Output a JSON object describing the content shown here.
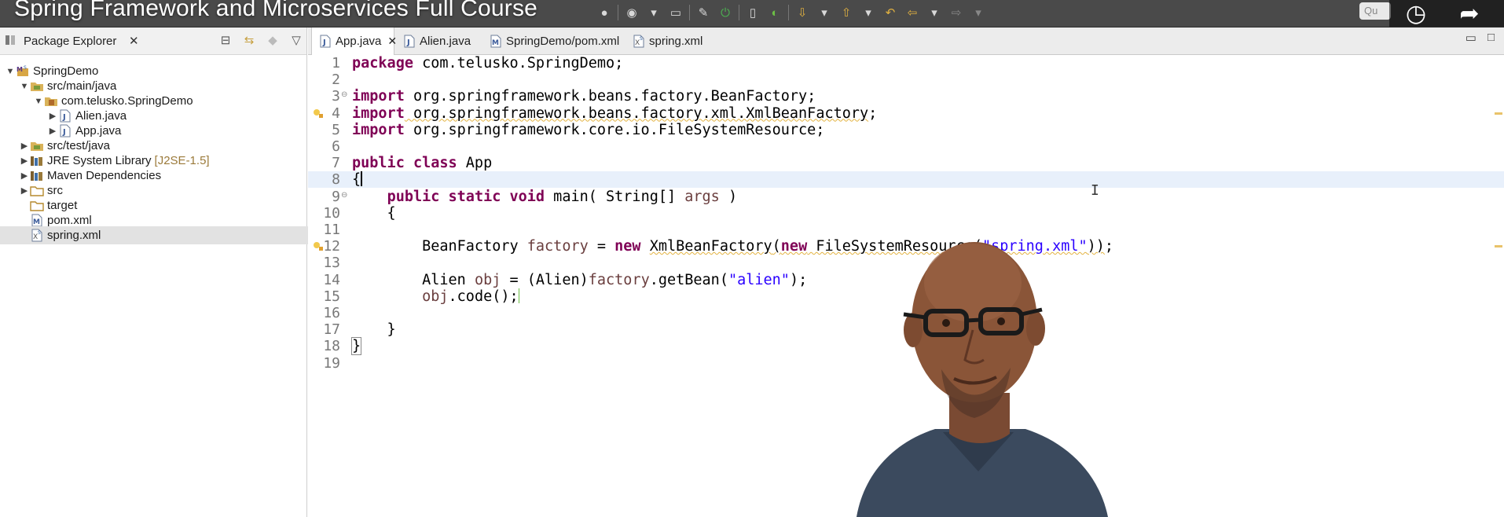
{
  "video": {
    "title": "Spring Framework and Microservices Full Course",
    "search_placeholder": "Qu"
  },
  "explorer": {
    "tab_label": "Package Explorer",
    "items": [
      {
        "label": "SpringDemo",
        "icon": "maven-project-icon",
        "level": 0,
        "expanded": true
      },
      {
        "label": "src/main/java",
        "icon": "source-folder-icon",
        "level": 1,
        "expanded": true
      },
      {
        "label": "com.telusko.SpringDemo",
        "icon": "package-icon",
        "level": 2,
        "expanded": true
      },
      {
        "label": "Alien.java",
        "icon": "java-file-icon",
        "level": 3,
        "expanded": false
      },
      {
        "label": "App.java",
        "icon": "java-file-icon",
        "level": 3,
        "expanded": false
      },
      {
        "label": "src/test/java",
        "icon": "source-folder-icon",
        "level": 1,
        "expanded": false
      },
      {
        "label": "JRE System Library",
        "decoration": "[J2SE-1.5]",
        "icon": "library-icon",
        "level": 1,
        "expanded": false
      },
      {
        "label": "Maven Dependencies",
        "icon": "library-icon",
        "level": 1,
        "expanded": false
      },
      {
        "label": "src",
        "icon": "folder-icon",
        "level": 1,
        "expanded": false
      },
      {
        "label": "target",
        "icon": "folder-icon",
        "level": 1,
        "expanded": null
      },
      {
        "label": "pom.xml",
        "icon": "maven-file-icon",
        "level": 1,
        "expanded": null
      },
      {
        "label": "spring.xml",
        "icon": "spring-xml-icon",
        "level": 1,
        "expanded": null,
        "selected": true
      }
    ]
  },
  "editor": {
    "tabs": [
      {
        "label": "App.java",
        "icon": "java-file-icon",
        "active": true
      },
      {
        "label": "Alien.java",
        "icon": "java-file-icon",
        "active": false
      },
      {
        "label": "SpringDemo/pom.xml",
        "icon": "maven-file-icon",
        "active": false
      },
      {
        "label": "spring.xml",
        "icon": "spring-xml-icon",
        "active": false
      }
    ],
    "lines": [
      {
        "n": "1",
        "tokens": [
          [
            "kw",
            "package"
          ],
          [
            "t",
            " com.telusko.SpringDemo;"
          ]
        ]
      },
      {
        "n": "2",
        "tokens": []
      },
      {
        "n": "3",
        "fold": true,
        "tokens": [
          [
            "kw",
            "import"
          ],
          [
            "t",
            " org.springframework.beans.factory.BeanFactory;"
          ]
        ]
      },
      {
        "n": "4",
        "warn": true,
        "tokens": [
          [
            "kw",
            "import"
          ],
          [
            "sq",
            " org.springframework.beans.factory.xml."
          ],
          [
            "sqs",
            "XmlBeanFactory"
          ],
          [
            "t",
            ";"
          ]
        ]
      },
      {
        "n": "5",
        "tokens": [
          [
            "kw",
            "import"
          ],
          [
            "t",
            " org.springframework.core.io.FileSystemResource;"
          ]
        ]
      },
      {
        "n": "6",
        "tokens": []
      },
      {
        "n": "7",
        "tokens": [
          [
            "kw",
            "public class"
          ],
          [
            "t",
            " App"
          ]
        ]
      },
      {
        "n": "8",
        "current": true,
        "tokens": [
          [
            "t",
            "{"
          ],
          [
            "caret",
            ""
          ]
        ]
      },
      {
        "n": "9",
        "fold": true,
        "tokens": [
          [
            "t",
            "    "
          ],
          [
            "kw",
            "public static void"
          ],
          [
            "t",
            " main( String[] "
          ],
          [
            "var",
            "args"
          ],
          [
            "t",
            " )"
          ]
        ]
      },
      {
        "n": "10",
        "tokens": [
          [
            "t",
            "    {"
          ]
        ]
      },
      {
        "n": "11",
        "tokens": []
      },
      {
        "n": "12",
        "warn": true,
        "tokens": [
          [
            "t",
            "        BeanFactory "
          ],
          [
            "var",
            "factory"
          ],
          [
            "t",
            " = "
          ],
          [
            "kw",
            "new"
          ],
          [
            "t",
            " "
          ],
          [
            "sqs",
            "XmlBeanFactory"
          ],
          [
            "sq",
            "("
          ],
          [
            "sqk",
            "new"
          ],
          [
            "sq",
            " FileSystemResource("
          ],
          [
            "sqstr",
            "\"spring.xml\""
          ],
          [
            "sq",
            "))"
          ],
          [
            "t",
            ";"
          ]
        ]
      },
      {
        "n": "13",
        "tokens": []
      },
      {
        "n": "14",
        "tokens": [
          [
            "t",
            "        Alien "
          ],
          [
            "var",
            "obj"
          ],
          [
            "t",
            " = (Alien)"
          ],
          [
            "var",
            "factory"
          ],
          [
            "t",
            ".getBean("
          ],
          [
            "str",
            "\"alien\""
          ],
          [
            "t",
            ");"
          ]
        ]
      },
      {
        "n": "15",
        "tokens": [
          [
            "t",
            "        "
          ],
          [
            "var",
            "obj"
          ],
          [
            "t",
            ".code();"
          ],
          [
            "caretthin",
            ""
          ]
        ]
      },
      {
        "n": "16",
        "tokens": []
      },
      {
        "n": "17",
        "tokens": [
          [
            "t",
            "    }"
          ]
        ]
      },
      {
        "n": "18",
        "tokens": [
          [
            "box",
            "}"
          ]
        ]
      },
      {
        "n": "19",
        "tokens": []
      }
    ]
  },
  "colors": {
    "keyword": "#7f0055",
    "string": "#2a00ff",
    "variable": "#6a3e3e",
    "warning": "#e3b341",
    "current_line": "#e8f0fb"
  }
}
